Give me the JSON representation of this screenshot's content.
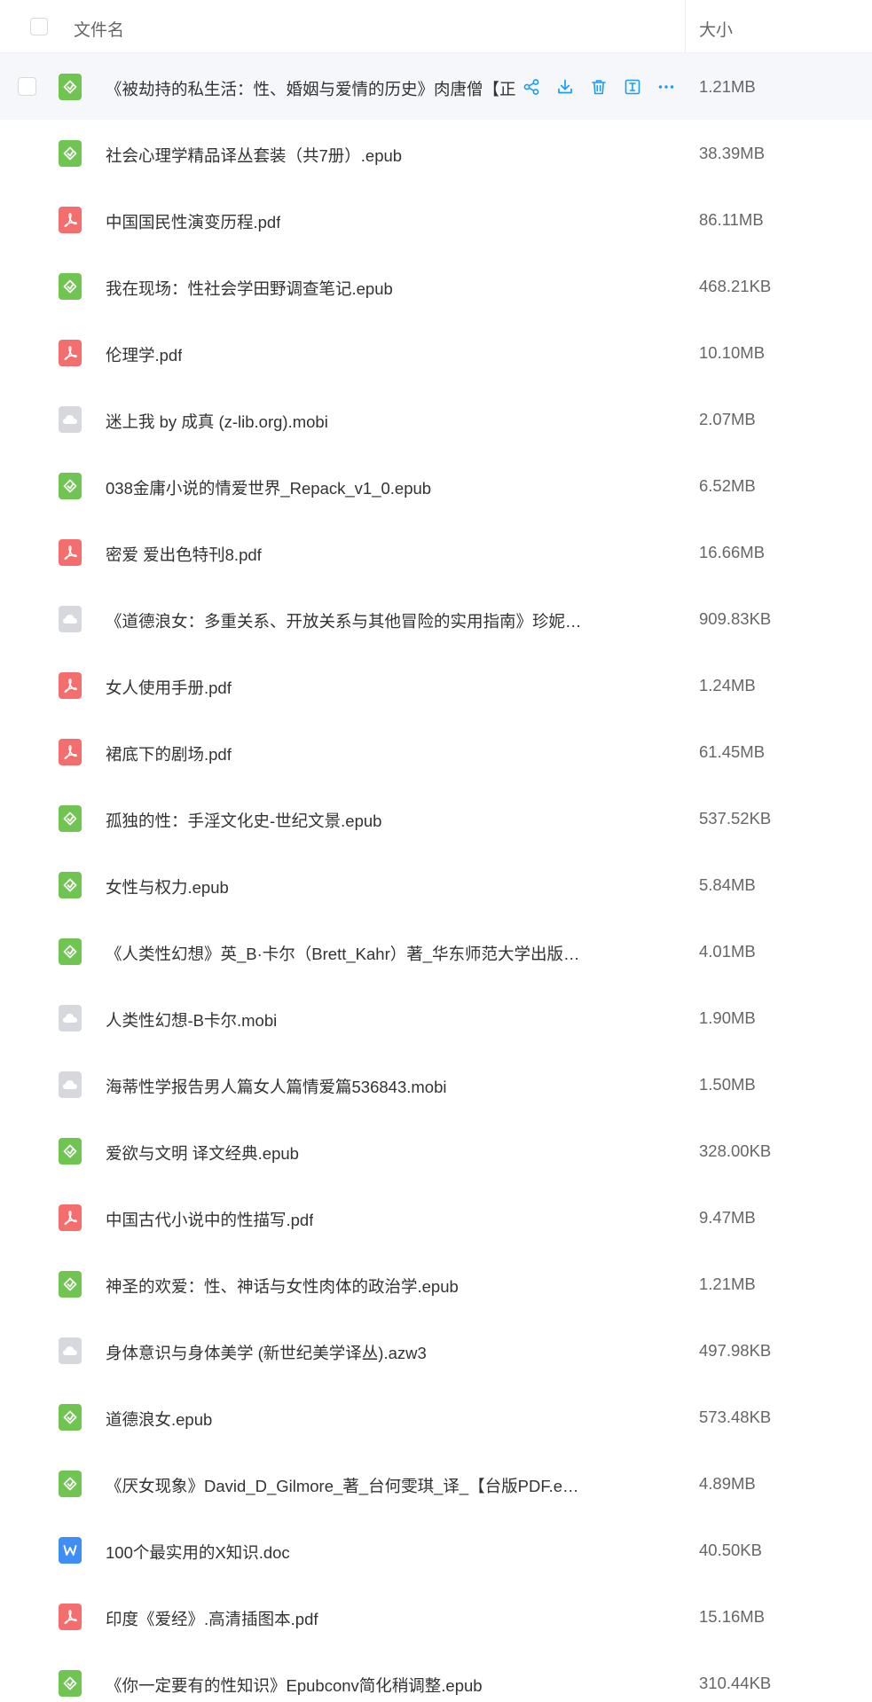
{
  "header": {
    "name_label": "文件名",
    "size_label": "大小"
  },
  "colors": {
    "epub": "#6fc452",
    "pdf": "#f46e6e",
    "mobi": "#d6d8de",
    "doc": "#3f8ef5",
    "accent": "#1a9cf4"
  },
  "hover_actions": [
    "share-icon",
    "download-icon",
    "delete-icon",
    "rename-icon",
    "more-icon"
  ],
  "files": [
    {
      "name": "《被劫持的私生活：性、婚姻与爱情的历史》肉唐僧【正版",
      "size": "1.21MB",
      "type": "epub",
      "hovered": true
    },
    {
      "name": "社会心理学精品译丛套装（共7册）.epub",
      "size": "38.39MB",
      "type": "epub"
    },
    {
      "name": "中国国民性演变历程.pdf",
      "size": "86.11MB",
      "type": "pdf"
    },
    {
      "name": "我在现场：性社会学田野调查笔记.epub",
      "size": "468.21KB",
      "type": "epub"
    },
    {
      "name": "伦理学.pdf",
      "size": "10.10MB",
      "type": "pdf"
    },
    {
      "name": "迷上我 by 成真 (z-lib.org).mobi",
      "size": "2.07MB",
      "type": "mobi"
    },
    {
      "name": "038金庸小说的情爱世界_Repack_v1_0.epub",
      "size": "6.52MB",
      "type": "epub"
    },
    {
      "name": "密爱 爱出色特刊8.pdf",
      "size": "16.66MB",
      "type": "pdf"
    },
    {
      "name": "《道德浪女：多重关系、开放关系与其他冒险的实用指南》珍妮．...",
      "size": "909.83KB",
      "type": "mobi"
    },
    {
      "name": "女人使用手册.pdf",
      "size": "1.24MB",
      "type": "pdf"
    },
    {
      "name": "裙底下的剧场.pdf",
      "size": "61.45MB",
      "type": "pdf"
    },
    {
      "name": "孤独的性：手淫文化史-世纪文景.epub",
      "size": "537.52KB",
      "type": "epub"
    },
    {
      "name": "女性与权力.epub",
      "size": "5.84MB",
      "type": "epub"
    },
    {
      "name": "《人类性幻想》英_B·卡尔（Brett_Kahr）著_华东师范大学出版社....",
      "size": "4.01MB",
      "type": "epub"
    },
    {
      "name": "人类性幻想-B卡尔.mobi",
      "size": "1.90MB",
      "type": "mobi"
    },
    {
      "name": "海蒂性学报告男人篇女人篇情爱篇536843.mobi",
      "size": "1.50MB",
      "type": "mobi"
    },
    {
      "name": "爱欲与文明 译文经典.epub",
      "size": "328.00KB",
      "type": "epub"
    },
    {
      "name": "中国古代小说中的性描写.pdf",
      "size": "9.47MB",
      "type": "pdf"
    },
    {
      "name": "神圣的欢爱：性、神话与女性肉体的政治学.epub",
      "size": "1.21MB",
      "type": "epub"
    },
    {
      "name": "身体意识与身体美学 (新世纪美学译丛).azw3",
      "size": "497.98KB",
      "type": "mobi"
    },
    {
      "name": "道德浪女.epub",
      "size": "573.48KB",
      "type": "epub"
    },
    {
      "name": "《厌女现象》David_D_Gilmore_著_台何雯琪_译_【台版PDF.epub",
      "size": "4.89MB",
      "type": "epub"
    },
    {
      "name": "100个最实用的X知识.doc",
      "size": "40.50KB",
      "type": "doc"
    },
    {
      "name": "印度《爱经》.高清插图本.pdf",
      "size": "15.16MB",
      "type": "pdf"
    },
    {
      "name": "《你一定要有的性知识》Epubconv简化稍调整.epub",
      "size": "310.44KB",
      "type": "epub"
    }
  ]
}
